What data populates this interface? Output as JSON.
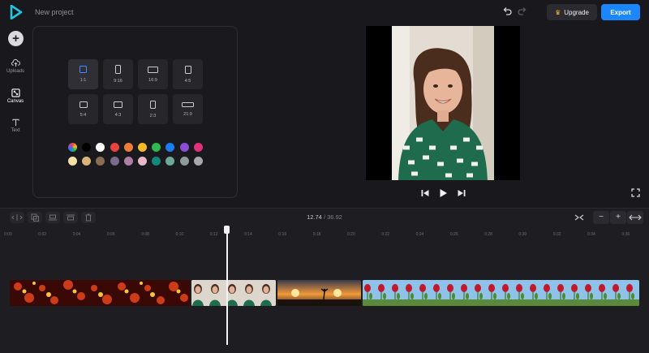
{
  "app": {
    "project_title": "New project"
  },
  "toolbar": {
    "upgrade_label": "Upgrade",
    "export_label": "Export"
  },
  "rail": {
    "items": [
      {
        "label": "Uploads",
        "icon": "upload-cloud-icon"
      },
      {
        "label": "Canvas",
        "icon": "canvas-resize-icon"
      },
      {
        "label": "Text",
        "icon": "text-icon"
      }
    ]
  },
  "canvas": {
    "ratios": [
      {
        "label": "1:1",
        "selected": true
      },
      {
        "label": "9:16",
        "selected": false
      },
      {
        "label": "16:9",
        "selected": false
      },
      {
        "label": "4:5",
        "selected": false
      },
      {
        "label": "5:4",
        "selected": false
      },
      {
        "label": "4:3",
        "selected": false
      },
      {
        "label": "2:3",
        "selected": false
      },
      {
        "label": "21:9",
        "selected": false
      }
    ],
    "colors_row1": [
      "rainbow",
      "#000000",
      "#ffffff",
      "#e8433c",
      "#f07b3a",
      "#f7b928",
      "#2fb84f",
      "#1a7ef2",
      "#8a4fd8",
      "#e0327a"
    ],
    "colors_row2": [
      "#f7e0a8",
      "#d9b47a",
      "#8a6e52",
      "#7a6a8e",
      "#b07ea0",
      "#e8b8c8",
      "#0f8a7c",
      "#6ea89a",
      "#8e9a9c",
      "#a8a8ad"
    ]
  },
  "timeline": {
    "current_time": "12.74",
    "separator": "/",
    "total_time": "36.92",
    "zoom_minus": "−",
    "zoom_plus": "+",
    "ticks": [
      "0:00",
      "0:02",
      "0:04",
      "0:06",
      "0:08",
      "0:10",
      "0:12",
      "0:14",
      "0:16",
      "0:18",
      "0:20",
      "0:22",
      "0:24",
      "0:26",
      "0:28",
      "0:30",
      "0:32",
      "0:34",
      "0:36"
    ]
  }
}
